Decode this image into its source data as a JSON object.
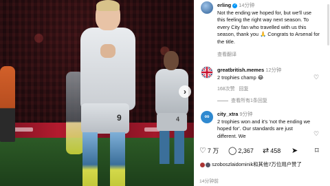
{
  "post": {
    "username": "erling",
    "verified_icon": "verified-badge-icon",
    "caption_time": "14分钟",
    "caption": "Not the ending we hoped for, but we'll use this feeling the right way next season. To every City fan who travelled with us this season, thank you 🙏 Congrats to Arsenal for the title.",
    "see_translation": "查看翻译",
    "jersey_number": "9",
    "right_player_number": "4"
  },
  "comments": [
    {
      "username": "greatbritish.memes",
      "time": "12分钟",
      "text": "2 trophies champ 😂",
      "likes": "168次赞",
      "reply_label": "回复",
      "view_replies": "查看所有1条回复"
    },
    {
      "username": "city_xtra",
      "time": "9分钟",
      "text": "2 trophies won and it's 'not the ending we hoped for'. Our standards are just different. We"
    }
  ],
  "actions": {
    "likes_count": "7 万",
    "comments_count": "2,367",
    "shares_count": "458"
  },
  "liked_by": {
    "text": "szoboszlaidominik和其他7万位用户赞了"
  },
  "timestamp": "14分钟前",
  "colors": {
    "accent": "#0095f6",
    "city_blue": "#2f89d0"
  }
}
